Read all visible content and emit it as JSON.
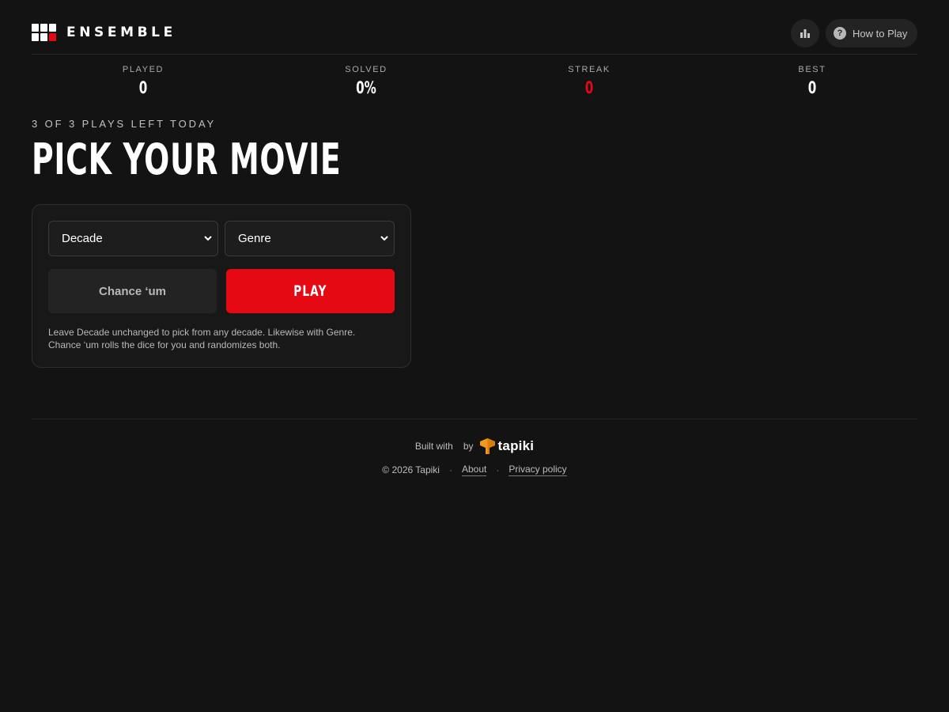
{
  "header": {
    "brand": "ENSEMBLE",
    "stats_icon": "bar-chart-icon",
    "help_icon": "question-circle-icon",
    "how_to_play_label": "How to Play"
  },
  "stats": [
    {
      "label": "PLAYED",
      "value": "0"
    },
    {
      "label": "SOLVED",
      "value": "0%"
    },
    {
      "label": "STREAK",
      "value": "0"
    },
    {
      "label": "BEST",
      "value": "0"
    }
  ],
  "main": {
    "plays_left": "3 OF 3 PLAYS LEFT TODAY",
    "title": "PICK YOUR MOVIE"
  },
  "picker": {
    "decade_value": "Decade",
    "genre_value": "Genre",
    "chance_label": "Chance ‘um",
    "play_label": "PLAY",
    "helper_line1": "Leave Decade unchanged to pick from any decade. Likewise with Genre.",
    "helper_line2": "Chance ‘um rolls the dice for you and randomizes both."
  },
  "footer": {
    "built_with": "Built with",
    "by": "by",
    "tapiki_name": "tapiki",
    "copyright": "© 2026 Tapiki",
    "about_label": "About",
    "privacy_label": "Privacy policy",
    "separator": "·"
  },
  "colors": {
    "background": "#131313",
    "accent_red": "#e50914",
    "tapiki_orange": "#f29a1e"
  }
}
